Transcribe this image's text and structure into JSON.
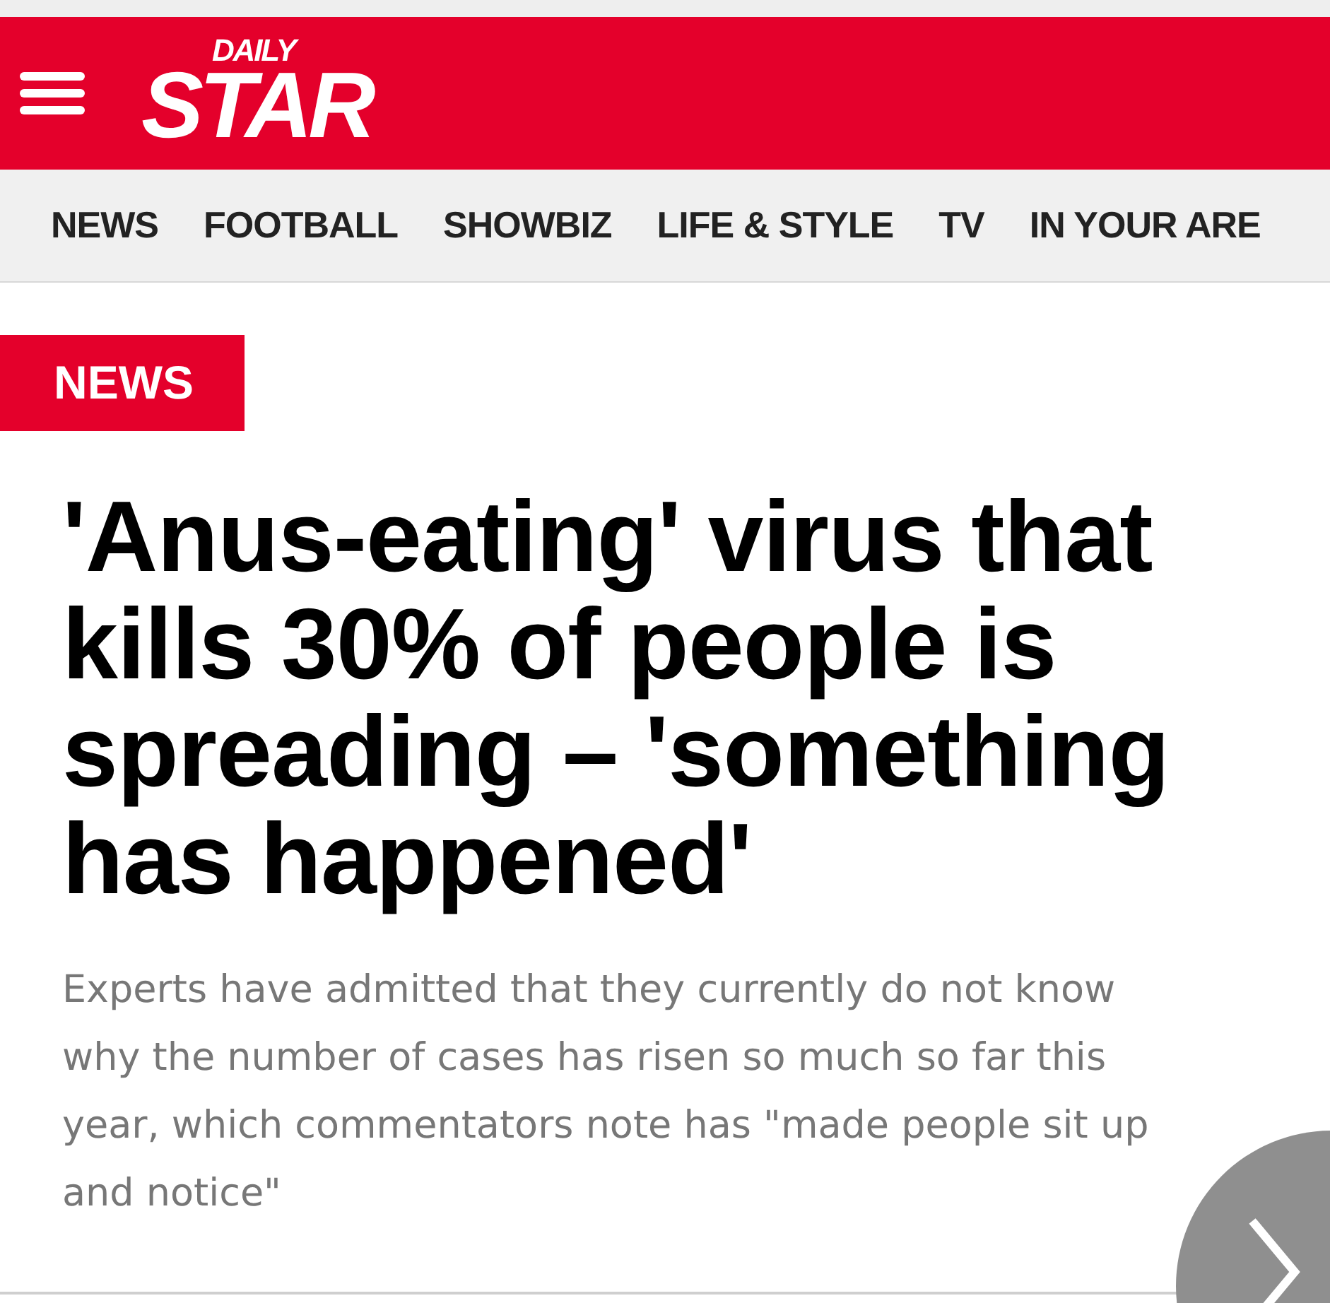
{
  "header": {
    "logo": {
      "top": "DAILY",
      "main": "STAR"
    }
  },
  "nav": {
    "items": [
      {
        "label": "NEWS"
      },
      {
        "label": "FOOTBALL"
      },
      {
        "label": "SHOWBIZ"
      },
      {
        "label": "LIFE & STYLE"
      },
      {
        "label": "TV"
      },
      {
        "label": "IN YOUR ARE"
      }
    ]
  },
  "article": {
    "section": "NEWS",
    "headline": "'Anus-eating' virus that kills 30% of people is spreading – 'something has happened'",
    "standfirst": "Experts have admitted that they currently do not know why the number of cases has risen so much so far this year, which commentators note has \"made people sit up and notice\""
  }
}
